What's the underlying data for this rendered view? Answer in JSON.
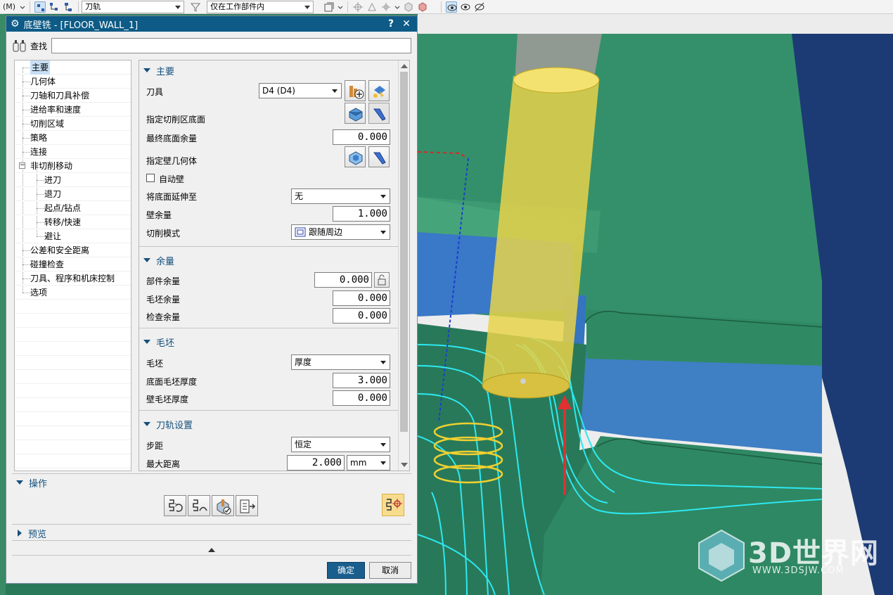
{
  "toolbar": {
    "menu_label": "(M)",
    "combo_toolpath": "刀轨",
    "combo_scope": "仅在工作部件内"
  },
  "dialog": {
    "title": "底壁铣 - [FLOOR_WALL_1]",
    "help_glyph": "?",
    "close_glyph": "✕",
    "find_label": "查找",
    "find_value": ""
  },
  "nav": {
    "items": [
      {
        "label": "主要",
        "level": 0,
        "selected": true
      },
      {
        "label": "几何体",
        "level": 0
      },
      {
        "label": "刀轴和刀具补偿",
        "level": 0
      },
      {
        "label": "进给率和速度",
        "level": 0
      },
      {
        "label": "切削区域",
        "level": 0
      },
      {
        "label": "策略",
        "level": 0
      },
      {
        "label": "连接",
        "level": 0
      },
      {
        "label": "非切削移动",
        "level": 0,
        "expanded": true
      },
      {
        "label": "进刀",
        "level": 1
      },
      {
        "label": "退刀",
        "level": 1
      },
      {
        "label": "起点/钻点",
        "level": 1
      },
      {
        "label": "转移/快速",
        "level": 1
      },
      {
        "label": "避让",
        "level": 1
      },
      {
        "label": "公差和安全距离",
        "level": 0
      },
      {
        "label": "碰撞检查",
        "level": 0
      },
      {
        "label": "刀具、程序和机床控制",
        "level": 0
      },
      {
        "label": "选项",
        "level": 0
      }
    ],
    "expander_glyph": "−"
  },
  "main": {
    "header": "主要",
    "tool_label": "刀具",
    "tool_value": "D4 (D4)",
    "floor_label": "指定切削区底面",
    "final_floor_stock_label": "最终底面余量",
    "final_floor_stock_value": "0.000",
    "wall_geom_label": "指定壁几何体",
    "auto_wall_label": "自动壁",
    "extend_floor_label": "将底面延伸至",
    "extend_floor_value": "无",
    "wall_stock_label": "壁余量",
    "wall_stock_value": "1.000",
    "cut_pattern_label": "切削模式",
    "cut_pattern_value": "跟随周边"
  },
  "stock": {
    "header": "余量",
    "part_stock_label": "部件余量",
    "part_stock_value": "0.000",
    "blank_stock_label": "毛坯余量",
    "blank_stock_value": "0.000",
    "check_stock_label": "检查余量",
    "check_stock_value": "0.000"
  },
  "blank": {
    "header": "毛坯",
    "blank_label": "毛坯",
    "blank_value": "厚度",
    "floor_blank_label": "底面毛坯厚度",
    "floor_blank_value": "3.000",
    "wall_blank_label": "壁毛坯厚度",
    "wall_blank_value": "0.000"
  },
  "path": {
    "header": "刀轨设置",
    "stepover_label": "步距",
    "stepover_value": "恒定",
    "max_dist_label": "最大距离",
    "max_dist_value": "2.000",
    "max_dist_unit": "mm"
  },
  "operation": {
    "header": "操作"
  },
  "preview": {
    "header": "预览"
  },
  "buttons": {
    "ok": "确定",
    "cancel": "取消"
  },
  "watermark": {
    "text": "3D世界网",
    "url": "WWW.3DSJW.COM"
  },
  "colors": {
    "title_bar": "#0d5b86",
    "section_head": "#14507c",
    "model_green": "#2f8a64",
    "model_blue": "#3f7fc4",
    "tool_yellow": "#e8d24a",
    "toolpath_cyan": "#2de8f0",
    "ok_button": "#1a5e8e"
  }
}
